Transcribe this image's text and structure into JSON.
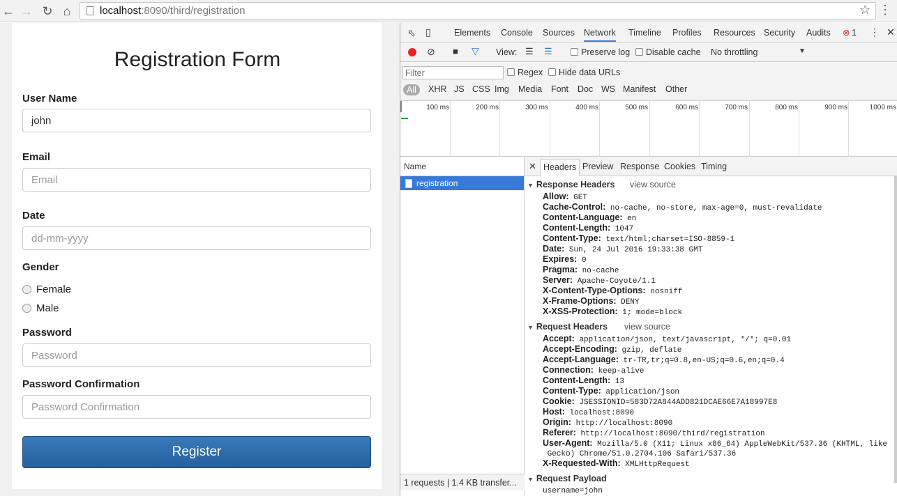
{
  "browser": {
    "url_host": "localhost",
    "url_rest": ":8090/third/registration"
  },
  "form": {
    "title": "Registration Form",
    "username_label": "User Name",
    "username_value": "john",
    "email_label": "Email",
    "email_placeholder": "Email",
    "date_label": "Date",
    "date_placeholder": "dd-mm-yyyy",
    "gender_label": "Gender",
    "gender_options": [
      "Female",
      "Male"
    ],
    "password_label": "Password",
    "password_placeholder": "Password",
    "confirm_label": "Password Confirmation",
    "confirm_placeholder": "Password Confirmation",
    "register_button": "Register"
  },
  "devtools": {
    "tabs": [
      "Elements",
      "Console",
      "Sources",
      "Network",
      "Timeline",
      "Profiles",
      "Resources",
      "Security",
      "Audits"
    ],
    "active_tab": "Network",
    "error_count": "1",
    "view_label": "View:",
    "preserve_log": "Preserve log",
    "disable_cache": "Disable cache",
    "throttling": "No throttling",
    "filter_placeholder": "Filter",
    "regex": "Regex",
    "hide_data_urls": "Hide data URLs",
    "filter_types": [
      "All",
      "XHR",
      "JS",
      "CSS",
      "Img",
      "Media",
      "Font",
      "Doc",
      "WS",
      "Manifest",
      "Other"
    ],
    "timeline_ticks": [
      "100 ms",
      "200 ms",
      "300 ms",
      "400 ms",
      "500 ms",
      "600 ms",
      "700 ms",
      "800 ms",
      "900 ms",
      "1000 ms"
    ],
    "name_header": "Name",
    "request_name": "registration",
    "status": "1 requests | 1.4 KB transfer...",
    "detail_tabs": [
      "Headers",
      "Preview",
      "Response",
      "Cookies",
      "Timing"
    ],
    "response_headers_title": "Response Headers",
    "request_headers_title": "Request Headers",
    "request_payload_title": "Request Payload",
    "view_source": "view source",
    "response_headers": [
      {
        "k": "Allow:",
        "v": "GET"
      },
      {
        "k": "Cache-Control:",
        "v": "no-cache, no-store, max-age=0, must-revalidate"
      },
      {
        "k": "Content-Language:",
        "v": "en"
      },
      {
        "k": "Content-Length:",
        "v": "1047"
      },
      {
        "k": "Content-Type:",
        "v": "text/html;charset=ISO-8859-1"
      },
      {
        "k": "Date:",
        "v": "Sun, 24 Jul 2016 19:33:38 GMT"
      },
      {
        "k": "Expires:",
        "v": "0"
      },
      {
        "k": "Pragma:",
        "v": "no-cache"
      },
      {
        "k": "Server:",
        "v": "Apache-Coyote/1.1"
      },
      {
        "k": "X-Content-Type-Options:",
        "v": "nosniff"
      },
      {
        "k": "X-Frame-Options:",
        "v": "DENY"
      },
      {
        "k": "X-XSS-Protection:",
        "v": "1; mode=block"
      }
    ],
    "request_headers": [
      {
        "k": "Accept:",
        "v": "application/json, text/javascript, */*; q=0.01"
      },
      {
        "k": "Accept-Encoding:",
        "v": "gzip, deflate"
      },
      {
        "k": "Accept-Language:",
        "v": "tr-TR,tr;q=0.8,en-US;q=0.6,en;q=0.4"
      },
      {
        "k": "Connection:",
        "v": "keep-alive"
      },
      {
        "k": "Content-Length:",
        "v": "13"
      },
      {
        "k": "Content-Type:",
        "v": "application/json"
      },
      {
        "k": "Cookie:",
        "v": "JSESSIONID=583D72A844ADD821DCAE66E7A18997E8"
      },
      {
        "k": "Host:",
        "v": "localhost:8090"
      },
      {
        "k": "Origin:",
        "v": "http://localhost:8090"
      },
      {
        "k": "Referer:",
        "v": "http://localhost:8090/third/registration"
      },
      {
        "k": "User-Agent:",
        "v": "Mozilla/5.0 (X11; Linux x86_64) AppleWebKit/537.36 (KHTML, like\n Gecko) Chrome/51.0.2704.106 Safari/537.36"
      },
      {
        "k": "X-Requested-With:",
        "v": "XMLHttpRequest"
      }
    ],
    "payload": "username=john"
  }
}
